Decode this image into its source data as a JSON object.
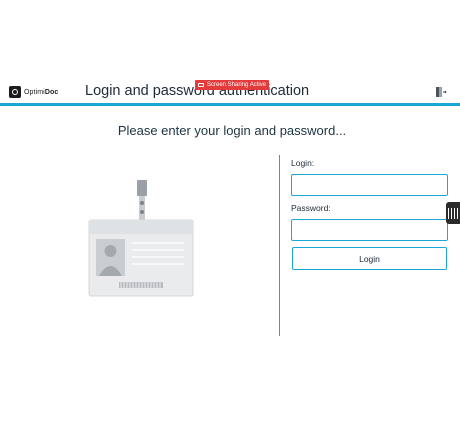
{
  "header": {
    "logo_prefix": "Optimi",
    "logo_suffix": "Doc",
    "title": "Login and password authentication",
    "screen_share_badge": "Screen Sharing Active",
    "accent_color": "#1aa7d4",
    "badge_color": "#e23b3b"
  },
  "main": {
    "prompt": "Please enter your login and password...",
    "login_label": "Login:",
    "login_value": "",
    "password_label": "Password:",
    "password_value": "",
    "login_button": "Login"
  },
  "icons": {
    "logo": "optimidoc-logo-icon",
    "logout": "logout-door-icon",
    "id_card": "id-badge-illustration",
    "side_panel": "side-panel-handle-icon"
  }
}
